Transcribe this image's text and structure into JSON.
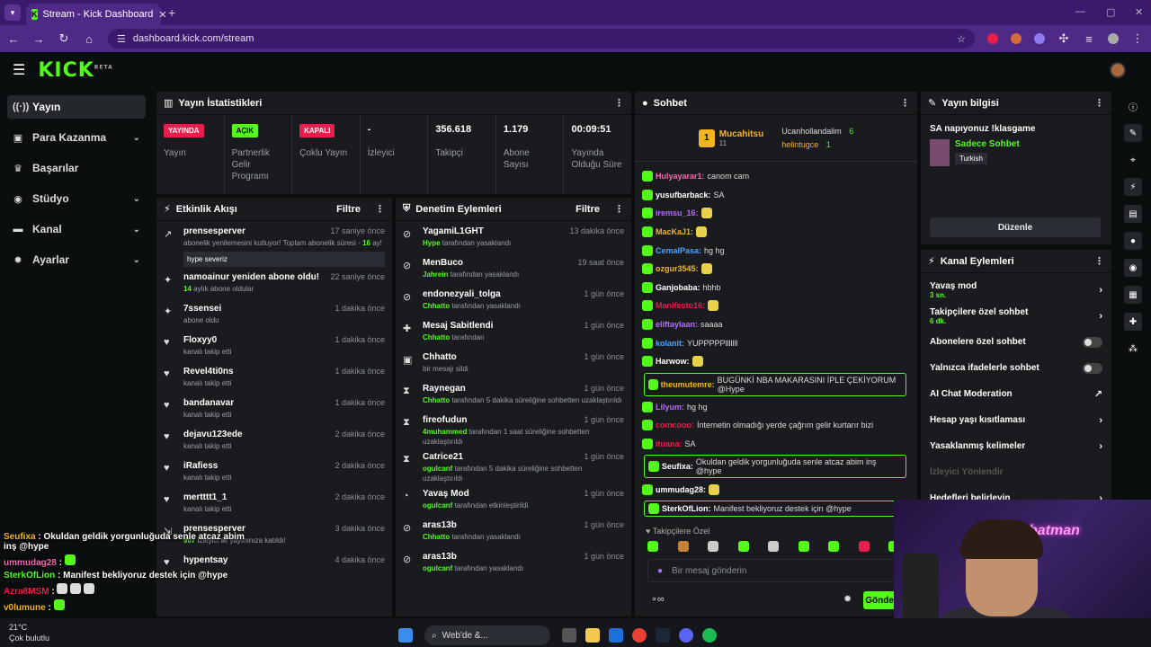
{
  "browser": {
    "tab_title": "Stream - Kick Dashboard",
    "url": "dashboard.kick.com/stream"
  },
  "header": {
    "logo": "KICK",
    "logo_beta": "BETA"
  },
  "sidebar": {
    "items": [
      {
        "label": "Yayın",
        "icon": "signal-icon"
      },
      {
        "label": "Para Kazanma",
        "icon": "money-icon"
      },
      {
        "label": "Başarılar",
        "icon": "trophy-icon"
      },
      {
        "label": "Stüdyo",
        "icon": "studio-icon"
      },
      {
        "label": "Kanal",
        "icon": "channel-icon"
      },
      {
        "label": "Ayarlar",
        "icon": "gear-icon"
      }
    ]
  },
  "stats": {
    "title": "Yayın İstatistikleri",
    "items": [
      {
        "badge": "YAYINDA",
        "label": "Yayın"
      },
      {
        "badge": "AÇIK",
        "label": "Partnerlik Gelir Programı"
      },
      {
        "badge": "KAPALI",
        "label": "Çoklu Yayın"
      },
      {
        "value": "-",
        "label": "İzleyici"
      },
      {
        "value": "356.618",
        "label": "Takipçi"
      },
      {
        "value": "1.179",
        "label": "Abone Sayısı"
      },
      {
        "value": "00:09:51",
        "label": "Yayında Olduğu Süre"
      }
    ]
  },
  "activity": {
    "title": "Etkinlik Akışı",
    "filter": "Filtre",
    "items": [
      {
        "name": "prensesperver",
        "time": "17 saniye önce",
        "sub_pre": "abonelik yenilemesini kutluyor! Toplam abonelik süresi - ",
        "sub_hl": "16",
        "sub_post": " ay!",
        "quote": "hype severiz"
      },
      {
        "name": "namoainur yeniden abone oldu!",
        "time": "22 saniye önce",
        "sub_hl": "14",
        "sub_post": " aylık abone oldular"
      },
      {
        "name": "7ssensei",
        "time": "1 dakika önce",
        "sub_post": "abone oldu"
      },
      {
        "name": "Floxyy0",
        "time": "1 dakika önce",
        "sub_post": "kanalı takip etti"
      },
      {
        "name": "Revel4ti0ns",
        "time": "1 dakika önce",
        "sub_post": "kanalı takip etti"
      },
      {
        "name": "bandanavar",
        "time": "1 dakika önce",
        "sub_post": "kanalı takip etti"
      },
      {
        "name": "dejavu123ede",
        "time": "2 dakika önce",
        "sub_post": "kanalı takip etti"
      },
      {
        "name": "iRafiess",
        "time": "2 dakika önce",
        "sub_post": "kanalı takip etti"
      },
      {
        "name": "mertttt1_1",
        "time": "2 dakika önce",
        "sub_post": "kanalı takip etti"
      },
      {
        "name": "prensesperver",
        "time": "3 dakika önce",
        "sub_hl": "907",
        "sub_post": " izleyici ile yayınınıza katıldı!"
      },
      {
        "name": "hypentsay",
        "time": "4 dakika önce",
        "sub_post": ""
      }
    ]
  },
  "moderation": {
    "title": "Denetim Eylemleri",
    "filter": "Filtre",
    "items": [
      {
        "name": "YagamiL1GHT",
        "time": "13 dakika önce",
        "sub_hl": "Hype",
        "sub_post": " tarafından yasaklandı"
      },
      {
        "name": "MenBuco",
        "time": "19 saat önce",
        "sub_hl": "Jahrein",
        "sub_post": " tarafından yasaklandı"
      },
      {
        "name": "endonezyali_tolga",
        "time": "1 gün önce",
        "sub_hl": "Chhatto",
        "sub_post": " tarafından yasaklandı"
      },
      {
        "name": "Mesaj Sabitlendi",
        "time": "1 gün önce",
        "sub_hl": "Chhatto",
        "sub_post": " tarafından"
      },
      {
        "name": "Chhatto",
        "time": "1 gün önce",
        "sub_post": "bir mesajı sildi"
      },
      {
        "name": "Raynegan",
        "time": "1 gün önce",
        "sub_hl": "Chhatto",
        "sub_post": " tarafından 5 dakika süreliğine sohbetten uzaklaştırıldı"
      },
      {
        "name": "fireofudun",
        "time": "1 gün önce",
        "sub_hl": "4muhammed",
        "sub_post": " tarafından 1 saat süreliğine sohbetten uzaklaştırıldı"
      },
      {
        "name": "Catrice21",
        "time": "1 gün önce",
        "sub_hl": "ogulcanf",
        "sub_post": " tarafından 5 dakika süreliğine sohbetten uzaklaştırıldı"
      },
      {
        "name": "Yavaş Mod",
        "time": "1 gün önce",
        "sub_hl": "ogulcanf",
        "sub_post": " tarafından etkinleştirildi"
      },
      {
        "name": "aras13b",
        "time": "1 gün önce",
        "sub_hl": "Chhatto",
        "sub_post": " tarafından yasaklandı"
      },
      {
        "name": "aras13b",
        "time": "1 gün önce",
        "sub_hl": "ogulcanf",
        "sub_post": " tarafından yasaklandı"
      }
    ]
  },
  "chat": {
    "title": "Sohbet",
    "top": {
      "rank": "1",
      "first": "Mucahitsu",
      "first_count": "11",
      "second": "Ucanhollandalim",
      "second_count": "6",
      "third": "helintugce",
      "third_count": "1"
    },
    "messages": [
      {
        "user": "Hulyayarar1",
        "color": "#f06ab2",
        "text": "canom cam"
      },
      {
        "user": "yusufbarback",
        "color": "#ffffff",
        "text": "SA"
      },
      {
        "user": "iremsu_16",
        "color": "#b46cff",
        "text": ""
      },
      {
        "user": "MacKaJ1",
        "color": "#f2b521",
        "text": ""
      },
      {
        "user": "CemalPasa",
        "color": "#4da3ff",
        "text": "hg hg"
      },
      {
        "user": "ozgur3545",
        "color": "#f2b521",
        "text": ""
      },
      {
        "user": "Ganjobaba",
        "color": "#ffffff",
        "text": "hbhb"
      },
      {
        "user": "Manifesto16",
        "color": "#e91e4d",
        "text": ""
      },
      {
        "user": "eliftaylaan",
        "color": "#b46cff",
        "text": "saaaa"
      },
      {
        "user": "kolanit",
        "color": "#4da3ff",
        "text": "YUPPPPPlllllll"
      },
      {
        "user": "Harwow",
        "color": "#ffffff",
        "text": ""
      },
      {
        "user": "theumutemre",
        "color": "#f2b521",
        "text": "BUGÜNKİ NBA MAKARASINI İPLE ÇEKİYORUM @Hype",
        "hl": true
      },
      {
        "user": "Lilyum",
        "color": "#b46cff",
        "text": "hg hg"
      },
      {
        "user": "comcooo",
        "color": "#e91e4d",
        "text": "İnternetin olmadığı yerde çağrım gelir kurtarır bizi"
      },
      {
        "user": "ituana",
        "color": "#e91e4d",
        "text": "SA"
      },
      {
        "user": "Seufixa",
        "color": "#ffffff",
        "text": "Okuldan geldik yorgunluğuda senle atcaz abim inş @hype",
        "hl": true
      },
      {
        "user": "ummudag28",
        "color": "#ffffff",
        "text": ""
      },
      {
        "user": "SterkOfLion",
        "color": "#ffffff",
        "text": "Manifest bekliyoruz destek için @hype",
        "hl": true
      }
    ],
    "followers_only": "Takipçilere Özel",
    "placeholder": "Bir mesaj gönderin",
    "send": "Gönder"
  },
  "stream_info": {
    "title": "Yayın bilgisi",
    "stream_title": "SA napıyonuz !klasgame",
    "category": "Sadece Sohbet",
    "tag": "Turkish",
    "edit": "Düzenle"
  },
  "channel_actions": {
    "title": "Kanal Eylemleri",
    "items": [
      {
        "label": "Yavaş mod",
        "sub": "3 sn.",
        "type": "arrow"
      },
      {
        "label": "Takipçilere özel sohbet",
        "sub": "6 dk.",
        "type": "arrow"
      },
      {
        "label": "Abonelere özel sohbet",
        "type": "toggle"
      },
      {
        "label": "Yalnızca ifadelerle sohbet",
        "type": "toggle"
      },
      {
        "label": "AI Chat Moderation",
        "type": "ext"
      },
      {
        "label": "Hesap yaşı kısıtlaması",
        "type": "arrow"
      },
      {
        "label": "Yasaklanmış kelimeler",
        "type": "arrow"
      },
      {
        "label": "İzleyici Yönlendir",
        "type": "disabled"
      },
      {
        "label": "Hedefleri belirleyin",
        "type": "arrow"
      }
    ]
  },
  "overlay": {
    "lines": [
      {
        "user": "Seufixa",
        "text": "Okuldan geldik yorgunluğuda senle atcaz abim inş @hype"
      },
      {
        "user": "ummudag28",
        "text": ""
      },
      {
        "user": "SterkOfLion",
        "text": "Manifest bekliyoruz destek için @hype"
      },
      {
        "user": "Azra8MSM",
        "text": ""
      },
      {
        "user": "v0lumune",
        "text": ""
      }
    ]
  },
  "taskbar": {
    "search": "Web'de &...",
    "weather_temp": "21°C",
    "weather_text": "Çok bulutlu"
  },
  "webcam": {
    "neon": "batman"
  }
}
